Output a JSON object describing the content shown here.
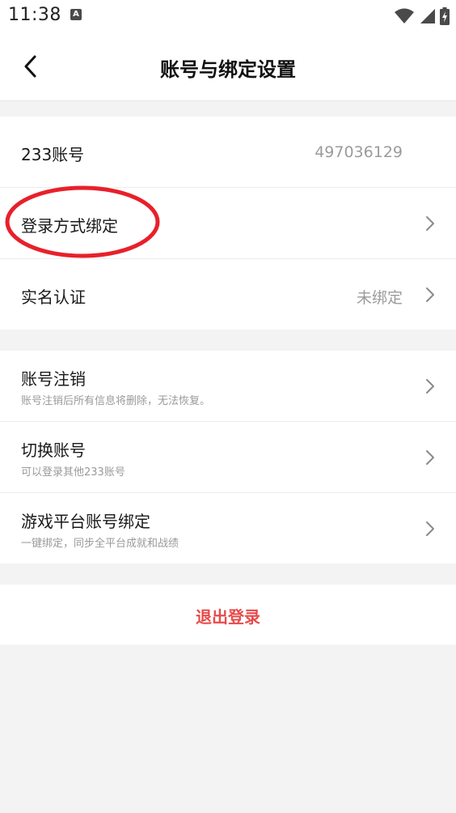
{
  "status_bar": {
    "time": "11:38",
    "notification_badge": "A",
    "icons": [
      "wifi-icon",
      "signal-icon",
      "battery-icon"
    ]
  },
  "header": {
    "back_icon": "chevron-left-icon",
    "title": "账号与绑定设置"
  },
  "account_group": {
    "account_id": {
      "label": "233账号",
      "value": "497036129"
    },
    "login_binding": {
      "label": "登录方式绑定"
    },
    "real_name": {
      "label": "实名认证",
      "value": "未绑定"
    }
  },
  "manage_group": {
    "cancel_account": {
      "label": "账号注销",
      "description": "账号注销后所有信息将删除，无法恢复。"
    },
    "switch_account": {
      "label": "切换账号",
      "description": "可以登录其他233账号"
    },
    "game_binding": {
      "label": "游戏平台账号绑定",
      "description": "一键绑定，同步全平台成就和战绩"
    }
  },
  "logout": {
    "label": "退出登录"
  },
  "colors": {
    "accent_red": "#e84a4a",
    "highlight_ring": "#e8202a",
    "background": "#f3f3f3"
  }
}
